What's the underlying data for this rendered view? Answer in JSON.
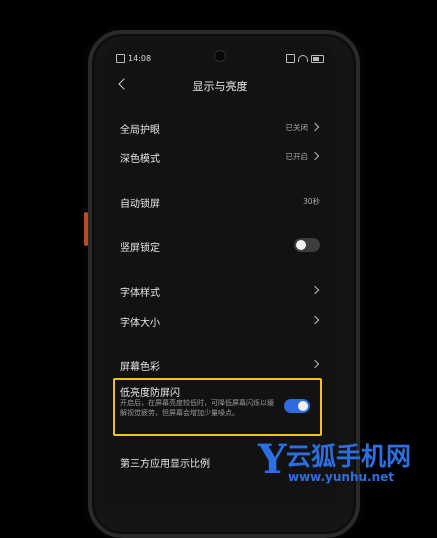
{
  "status_bar": {
    "time": "14:08"
  },
  "nav": {
    "title": "显示与亮度"
  },
  "settings": {
    "global_eye_care": {
      "label": "全局护眼",
      "value": "已关闭"
    },
    "dark_mode": {
      "label": "深色模式",
      "value": "已开启"
    },
    "auto_lock": {
      "label": "自动锁屏",
      "value": "30秒"
    },
    "portrait_lock": {
      "label": "竖屏锁定",
      "toggle": "off"
    },
    "font_style": {
      "label": "字体样式"
    },
    "font_size": {
      "label": "字体大小"
    },
    "screen_color": {
      "label": "屏幕色彩"
    },
    "low_brightness_flicker": {
      "label": "低亮度防屏闪",
      "description": "开启后，在屏幕亮度较低时，可降低屏幕闪烁以缓解视觉疲劳，但屏幕会增加少量噪点。",
      "toggle": "on"
    },
    "third_party_display_ratio": {
      "label": "第三方应用显示比例"
    }
  },
  "watermark": {
    "mark": "Y",
    "name": "云狐手机网",
    "url": "www.yunhu.net"
  },
  "colors": {
    "toggle_on": "#2f6bdc",
    "highlight_border": "#f2c21b",
    "watermark": "#2d6fe0"
  }
}
